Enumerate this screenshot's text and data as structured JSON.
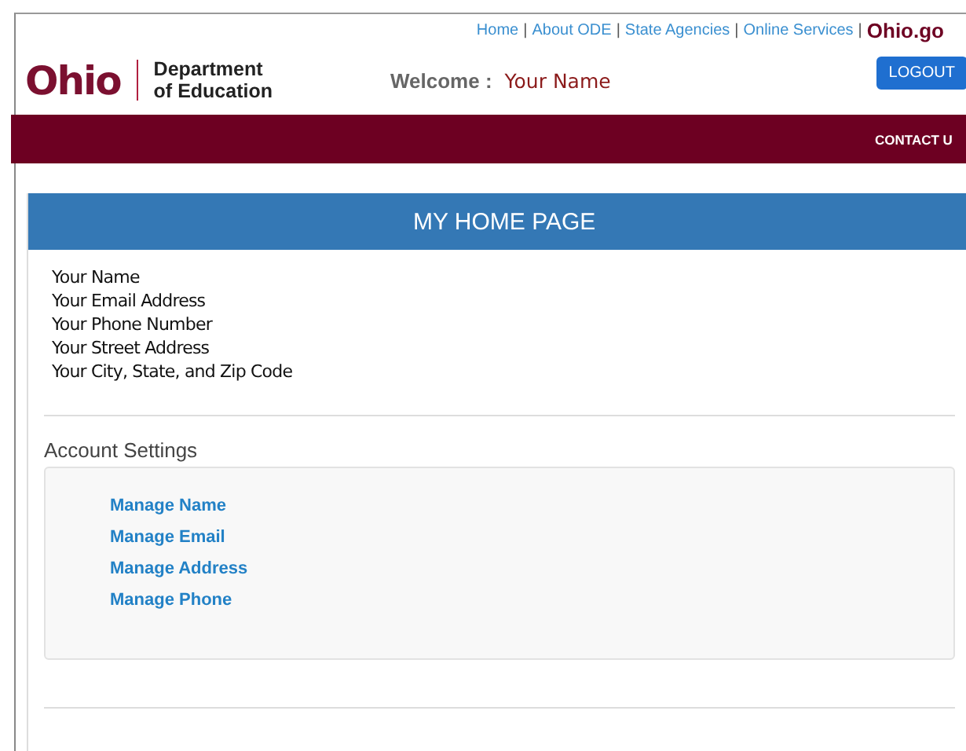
{
  "header": {
    "top_links": [
      "Home",
      "About ODE",
      "State Agencies",
      "Online Services"
    ],
    "separator": "|",
    "portal_logo": "Ohio.go",
    "logo": "Ohio",
    "department": "Department",
    "department_sub": "of Education",
    "welcome_label": "Welcome :",
    "welcome_name": "Your Name",
    "logout": "LOGOUT"
  },
  "nav": {
    "items": [
      "CONTACT U"
    ]
  },
  "card": {
    "title": "MY HOME PAGE",
    "profile": [
      "Your Name",
      "Your Email Address",
      "Your Phone Number",
      "Your Street Address",
      "Your City, State, and Zip Code"
    ],
    "settings_title": "Account Settings",
    "settings_links": [
      "Manage Name",
      "Manage Email",
      "Manage Address",
      "Manage Phone"
    ]
  }
}
